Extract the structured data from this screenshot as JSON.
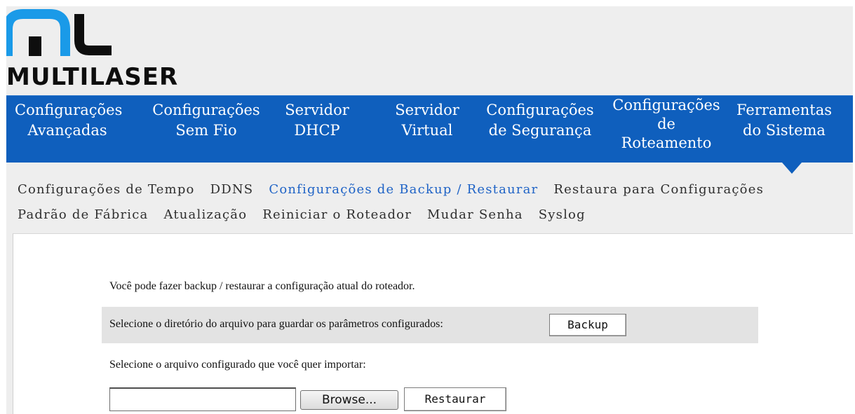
{
  "brand": {
    "name": "MULTILASER",
    "accent": "#0f5fbd",
    "logo_blue": "#1a9ae8"
  },
  "main_nav": [
    {
      "line1": "Configurações",
      "line2": "Avançadas"
    },
    {
      "line1": "Configurações",
      "line2": "Sem Fio"
    },
    {
      "line1": "Servidor",
      "line2": "DHCP"
    },
    {
      "line1": "Servidor",
      "line2": "Virtual"
    },
    {
      "line1": "Configurações",
      "line2": "de Segurança"
    },
    {
      "line1": "Configurações",
      "line2": "de",
      "line3": "Roteamento"
    },
    {
      "line1": "Ferramentas",
      "line2": "do Sistema"
    }
  ],
  "sub_nav": {
    "row1": [
      "Configurações de Tempo",
      "DDNS",
      "Configurações de Backup / Restaurar",
      "Restaura para Configurações"
    ],
    "row2": [
      "Padrão de Fábrica",
      "Atualização",
      "Reiniciar o Roteador",
      "Mudar Senha",
      "Syslog"
    ],
    "active": "Configurações de Backup / Restaurar"
  },
  "content": {
    "intro": "Você pode fazer backup / restaurar a configuração atual do roteador.",
    "backup_label": "Selecione o diretório do arquivo para guardar os parâmetros configurados:",
    "backup_button": "Backup",
    "import_label": "Selecione o arquivo configurado que você quer importar:",
    "file_value": "",
    "browse_button": "Browse...",
    "restore_button": "Restaurar"
  }
}
